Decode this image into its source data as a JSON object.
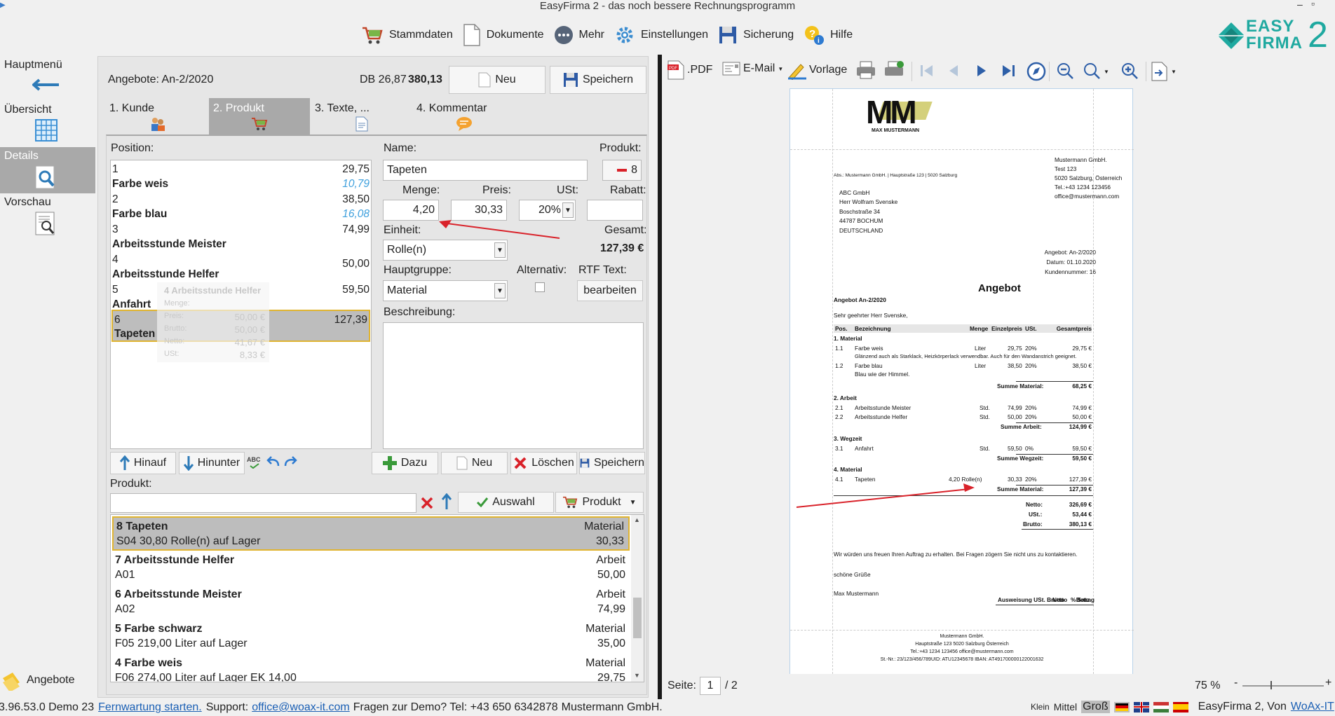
{
  "app": {
    "title": "EasyFirma 2 - das noch bessere Rechnungsprogramm",
    "logo_line1": "EASY",
    "logo_line2": "FIRMA",
    "logo_num": "2",
    "window_controls": [
      "–",
      "▫"
    ]
  },
  "topmenu": [
    {
      "label": "Stammdaten",
      "icon": "cart-icon"
    },
    {
      "label": "Dokumente",
      "icon": "document-icon"
    },
    {
      "label": "Mehr",
      "icon": "more-icon"
    },
    {
      "label": "Einstellungen",
      "icon": "gear-icon"
    },
    {
      "label": "Sicherung",
      "icon": "save-icon"
    },
    {
      "label": "Hilfe",
      "icon": "help-icon"
    }
  ],
  "sidebar": {
    "items": [
      {
        "label": "Hauptmenü",
        "icon": "back-arrow-icon"
      },
      {
        "label": "Übersicht",
        "icon": "calendar-grid-icon"
      },
      {
        "label": "Details",
        "icon": "magnifier-icon",
        "active": true
      },
      {
        "label": "Vorschau",
        "icon": "preview-icon"
      }
    ],
    "bottom_label": "Angebote"
  },
  "header": {
    "offer_label": "Angebote: An-2/2020",
    "db_label": "DB 26,87",
    "db_total": "380,13",
    "new_button": "Neu",
    "save_button": "Speichern"
  },
  "tabs": [
    {
      "label": "1. Kunde",
      "active": false
    },
    {
      "label": "2. Produkt",
      "active": true
    },
    {
      "label": "3. Texte, ...",
      "active": false
    },
    {
      "label": "4. Kommentar",
      "active": false
    }
  ],
  "position": {
    "label": "Position:",
    "rows": [
      {
        "num": "1",
        "amount": "29,75",
        "name": "Farbe weis",
        "unit_price": "10,79"
      },
      {
        "num": "2",
        "amount": "38,50",
        "name": "Farbe blau",
        "unit_price": "16,08"
      },
      {
        "num": "3",
        "amount": "74,99",
        "name": "Arbeitsstunde Meister",
        "unit_price": ""
      },
      {
        "num": "4",
        "amount": "50,00",
        "name": "Arbeitsstunde Helfer",
        "unit_price": ""
      },
      {
        "num": "5",
        "amount": "59,50",
        "name": "Anfahrt",
        "unit_price": ""
      },
      {
        "num": "6",
        "amount": "127,39",
        "name": "Tapeten",
        "unit_price": ""
      }
    ],
    "tooltip": {
      "title": "4 Arbeitsstunde Helfer",
      "menge_label": "Menge:",
      "preis_label": "Preis:",
      "preis": "50,00 €",
      "brutto_label": "Brutto:",
      "brutto": "50,00 €",
      "netto_label": "Netto:",
      "netto": "41,67 €",
      "ust_label": "USt:",
      "ust": "8,33 €"
    },
    "btn_up": "Hinauf",
    "btn_down": "Hinunter",
    "btn_abc": "ABC"
  },
  "form": {
    "name_label": "Name:",
    "name_value": "Tapeten",
    "product_label": "Produkt:",
    "product_value": "8",
    "menge_label": "Menge:",
    "menge_value": "4,20",
    "preis_label": "Preis:",
    "preis_value": "30,33",
    "ust_label": "USt:",
    "ust_value": "20%",
    "rabatt_label": "Rabatt:",
    "rabatt_value": "",
    "einheit_label": "Einheit:",
    "einheit_value": "Rolle(n)",
    "gesamt_label": "Gesamt:",
    "gesamt_value": "127,39 €",
    "hauptgruppe_label": "Hauptgruppe:",
    "hauptgruppe_value": "Material",
    "alternativ_label": "Alternativ:",
    "rtf_label": "RTF Text:",
    "rtf_button": "bearbeiten",
    "beschreibung_label": "Beschreibung:",
    "btn_dazu": "Dazu",
    "btn_neu": "Neu",
    "btn_loeschen": "Löschen",
    "btn_speichern": "Speichern"
  },
  "product_search": {
    "label": "Produkt:",
    "placeholder": "",
    "btn_auswahl": "Auswahl",
    "btn_produkt": "Produkt",
    "items": [
      {
        "title": "8 Tapeten",
        "group": "Material",
        "sub": "S04 30,80 Rolle(n) auf Lager",
        "price": "30,33",
        "selected": true
      },
      {
        "title": "7 Arbeitsstunde Helfer",
        "group": "Arbeit",
        "sub": "A01",
        "price": "50,00"
      },
      {
        "title": "6 Arbeitsstunde Meister",
        "group": "Arbeit",
        "sub": "A02",
        "price": "74,99"
      },
      {
        "title": "5 Farbe schwarz",
        "group": "Material",
        "sub": "F05 219,00 Liter auf Lager",
        "price": "35,00"
      },
      {
        "title": "4 Farbe weis",
        "group": "Material",
        "sub": "F06 274,00 Liter auf Lager EK 14,00",
        "price": "29,75"
      }
    ]
  },
  "preview_toolbar": {
    "pdf": ".PDF",
    "email": "E-Mail",
    "vorlage": "Vorlage"
  },
  "document": {
    "logo_text": "MM",
    "logo_sub": "MAX MUSTERMANN",
    "sender_line": "Abs.: Mustermann GmbH. | Hauptstraße 123 | 5020 Salzburg",
    "company": [
      "Mustermann GmbH.",
      "Test 123",
      "5020 Salzburg, Österreich",
      "Tel.:+43 1234 123456",
      "office@mustermann.com"
    ],
    "recipient": [
      "ABC GmbH",
      "Herr Wolfram Svenske",
      "Boschstraße 34",
      "44787 BOCHUM",
      "DEUTSCHLAND"
    ],
    "meta": [
      "Angebot: An-2/2020",
      "Datum: 01.10.2020",
      "Kundennummer: 16"
    ],
    "heading": "Angebot",
    "subheading": "Angebot An-2/2020",
    "greeting": "Sehr geehrter Herr Svenske,",
    "table_header": {
      "pos": "Pos.",
      "bez": "Bezeichnung",
      "menge": "Menge",
      "ep": "Einzelpreis",
      "ust": "USt.",
      "gp": "Gesamtpreis"
    },
    "groups": [
      {
        "title": "1. Material",
        "rows": [
          {
            "pos": "1.1",
            "bez": "Farbe weis",
            "menge": "Liter",
            "ep": "29,75",
            "ust": "20%",
            "gp": "29,75 €",
            "note": "Glänzend auch als Starklack, Heizkörperlack verwendbar. Auch für den Wandanstrich geeignet."
          },
          {
            "pos": "1.2",
            "bez": "Farbe blau",
            "menge": "Liter",
            "ep": "38,50",
            "ust": "20%",
            "gp": "38,50 €",
            "note": "Blau wie der Himmel."
          }
        ],
        "sum_label": "Summe Material:",
        "sum": "68,25 €"
      },
      {
        "title": "2. Arbeit",
        "rows": [
          {
            "pos": "2.1",
            "bez": "Arbeitsstunde Meister",
            "menge": "Std.",
            "ep": "74,99",
            "ust": "20%",
            "gp": "74,99 €",
            "note": ""
          },
          {
            "pos": "2.2",
            "bez": "Arbeitsstunde Helfer",
            "menge": "Std.",
            "ep": "50,00",
            "ust": "20%",
            "gp": "50,00 €",
            "note": ""
          }
        ],
        "sum_label": "Summe Arbeit:",
        "sum": "124,99 €"
      },
      {
        "title": "3. Wegzeit",
        "rows": [
          {
            "pos": "3.1",
            "bez": "Anfahrt",
            "menge": "Std.",
            "ep": "59,50",
            "ust": "0%",
            "gp": "59,50 €",
            "note": ""
          }
        ],
        "sum_label": "Summe Wegzeit:",
        "sum": "59,50 €"
      },
      {
        "title": "4. Material",
        "rows": [
          {
            "pos": "4.1",
            "bez": "Tapeten",
            "menge": "4,20 Rolle(n)",
            "ep": "30,33",
            "ust": "20%",
            "gp": "127,39 €",
            "note": ""
          }
        ],
        "sum_label": "Summe Material:",
        "sum": "127,39 €"
      }
    ],
    "totals": {
      "netto_label": "Netto:",
      "netto": "326,69 €",
      "ust_label": "USt.:",
      "ust": "53,44 €",
      "brutto_label": "Brutto:",
      "brutto": "380,13 €"
    },
    "closing": "Wir würden uns freuen Ihren Auftrag zu erhalten. Bei Fragen zögern Sie nicht uns zu kontaktieren.",
    "regards": "schöne Grüße",
    "signature": "Max Mustermann",
    "tax_header": {
      "a": "Ausweisung USt. Brutto",
      "b": "Netto",
      "c": "% Satz",
      "d": "Betrag"
    },
    "footer": [
      "Mustermann GmbH.",
      "Hauptstraße 123 5020 Salzburg Österreich",
      "Tel.:+43 1234 123456 office@mustermann.com",
      "St.-Nr.: 23/123/456/789UID: ATU12345678 IBAN: AT491700000122001632"
    ]
  },
  "pager": {
    "label": "Seite:",
    "current": "1",
    "total": "/ 2",
    "zoom": "75 %",
    "minus": "-",
    "plus": "+"
  },
  "status": {
    "version": "3.96.53.0 Demo 23",
    "remote_link": "Fernwartung starten.",
    "support_label": "Support:",
    "support_email": "office@woax-it.com",
    "demo_text": "Fragen zur Demo? Tel: +43 650 6342878",
    "company": "Mustermann GmbH.",
    "size_small": "Klein",
    "size_mid": "Mittel",
    "size_big": "Groß",
    "product": "EasyFirma 2, Von",
    "vendor_link": "WoAx-IT"
  },
  "colors": {
    "accent": "#2e7bb8",
    "selected_bg": "#bdbdbd",
    "selected_border": "#e0b431",
    "active_tab": "#a9a9a9",
    "logo": "#1fa9a0",
    "arrow": "#d9222a"
  }
}
